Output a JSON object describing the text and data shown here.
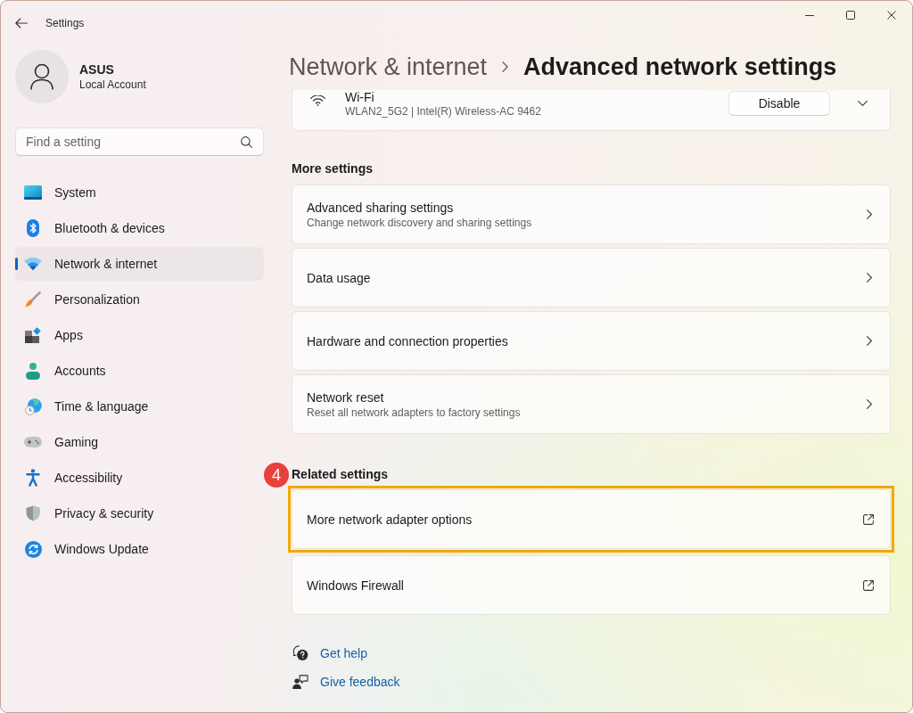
{
  "window": {
    "title": "Settings"
  },
  "account": {
    "name": "ASUS",
    "type": "Local Account"
  },
  "search": {
    "placeholder": "Find a setting"
  },
  "sidebar": {
    "items": [
      {
        "label": "System",
        "selected": false
      },
      {
        "label": "Bluetooth & devices",
        "selected": false
      },
      {
        "label": "Network & internet",
        "selected": true
      },
      {
        "label": "Personalization",
        "selected": false
      },
      {
        "label": "Apps",
        "selected": false
      },
      {
        "label": "Accounts",
        "selected": false
      },
      {
        "label": "Time & language",
        "selected": false
      },
      {
        "label": "Gaming",
        "selected": false
      },
      {
        "label": "Accessibility",
        "selected": false
      },
      {
        "label": "Privacy & security",
        "selected": false
      },
      {
        "label": "Windows Update",
        "selected": false
      }
    ]
  },
  "breadcrumb": {
    "parent": "Network & internet",
    "current": "Advanced network settings"
  },
  "adapter_card": {
    "title": "Wi-Fi",
    "subtitle": "WLAN2_5G2 | Intel(R) Wireless-AC 9462",
    "button": "Disable",
    "expanded": false
  },
  "more_settings": {
    "heading": "More settings",
    "items": [
      {
        "title": "Advanced sharing settings",
        "description": "Change network discovery and sharing settings"
      },
      {
        "title": "Data usage"
      },
      {
        "title": "Hardware and connection properties"
      },
      {
        "title": "Network reset",
        "description": "Reset all network adapters to factory settings"
      }
    ]
  },
  "related_settings": {
    "heading": "Related settings",
    "step_badge": "4",
    "items": [
      {
        "title": "More network adapter options",
        "highlighted": true
      },
      {
        "title": "Windows Firewall",
        "highlighted": false
      }
    ]
  },
  "help_links": [
    {
      "label": "Get help"
    },
    {
      "label": "Give feedback"
    }
  ]
}
